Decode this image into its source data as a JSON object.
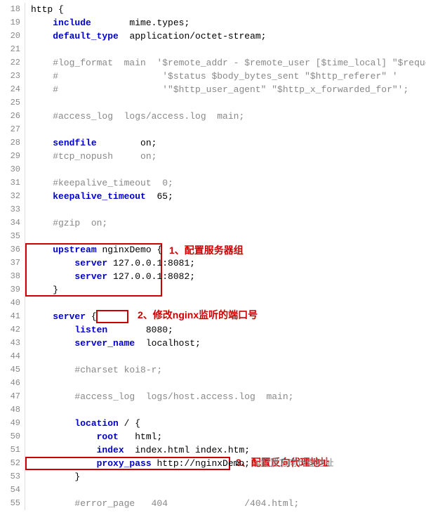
{
  "lines": [
    {
      "num": 18,
      "content": "http {",
      "tokens": [
        {
          "text": "http {",
          "class": "normal"
        }
      ]
    },
    {
      "num": 19,
      "content": "    include       mime.types;",
      "tokens": [
        {
          "text": "    ",
          "class": "normal"
        },
        {
          "text": "include",
          "class": "kw-blue"
        },
        {
          "text": "       mime.types;",
          "class": "normal"
        }
      ]
    },
    {
      "num": 20,
      "content": "    default_type  application/octet-stream;",
      "tokens": [
        {
          "text": "    ",
          "class": "normal"
        },
        {
          "text": "default_type",
          "class": "kw-blue"
        },
        {
          "text": "  application/octet-stream;",
          "class": "normal"
        }
      ]
    },
    {
      "num": 21,
      "content": "",
      "tokens": []
    },
    {
      "num": 22,
      "content": "    #log_format  main  '$remote_addr - $remote_user [$time_local] \"$request\" '",
      "tokens": [
        {
          "text": "    #log_format  main  '$remote_addr - $remote_user [$time_local] \"$request\" '",
          "class": "comment"
        }
      ]
    },
    {
      "num": 23,
      "content": "    #                   '$status $body_bytes_sent \"$http_referer\" '",
      "tokens": [
        {
          "text": "    #                   '$status $body_bytes_sent \"$http_referer\" '",
          "class": "comment"
        }
      ]
    },
    {
      "num": 24,
      "content": "    #                   '\"$http_user_agent\" \"$http_x_forwarded_for\"';",
      "tokens": [
        {
          "text": "    #                   '\"$http_user_agent\" \"$http_x_forwarded_for\"';",
          "class": "comment"
        }
      ]
    },
    {
      "num": 25,
      "content": "",
      "tokens": []
    },
    {
      "num": 26,
      "content": "    #access_log  logs/access.log  main;",
      "tokens": [
        {
          "text": "    #access_log  logs/access.log  main;",
          "class": "comment"
        }
      ]
    },
    {
      "num": 27,
      "content": "",
      "tokens": []
    },
    {
      "num": 28,
      "content": "    sendfile        on;",
      "tokens": [
        {
          "text": "    ",
          "class": "normal"
        },
        {
          "text": "sendfile",
          "class": "kw-blue"
        },
        {
          "text": "        on;",
          "class": "normal"
        }
      ]
    },
    {
      "num": 29,
      "content": "    #tcp_nopush     on;",
      "tokens": [
        {
          "text": "    #tcp_nopush     on;",
          "class": "comment"
        }
      ]
    },
    {
      "num": 30,
      "content": "",
      "tokens": []
    },
    {
      "num": 31,
      "content": "    #keepalive_timeout  0;",
      "tokens": [
        {
          "text": "    #keepalive_timeout  0;",
          "class": "comment"
        }
      ]
    },
    {
      "num": 32,
      "content": "    keepalive_timeout  65;",
      "tokens": [
        {
          "text": "    ",
          "class": "normal"
        },
        {
          "text": "keepalive_timeout",
          "class": "kw-blue"
        },
        {
          "text": "  65;",
          "class": "normal"
        }
      ]
    },
    {
      "num": 33,
      "content": "",
      "tokens": []
    },
    {
      "num": 34,
      "content": "    #gzip  on;",
      "tokens": [
        {
          "text": "    #gzip  on;",
          "class": "comment"
        }
      ]
    },
    {
      "num": 35,
      "content": "",
      "tokens": []
    },
    {
      "num": 36,
      "content": "    upstream nginxDemo {",
      "tokens": [
        {
          "text": "    ",
          "class": "normal"
        },
        {
          "text": "upstream",
          "class": "kw-blue"
        },
        {
          "text": " nginxDemo {",
          "class": "normal"
        }
      ]
    },
    {
      "num": 37,
      "content": "        server 127.0.0.1:8081;",
      "tokens": [
        {
          "text": "        ",
          "class": "normal"
        },
        {
          "text": "server",
          "class": "kw-blue"
        },
        {
          "text": " 127.0.0.1:8081;",
          "class": "normal"
        }
      ]
    },
    {
      "num": 38,
      "content": "        server 127.0.0.1:8082;",
      "tokens": [
        {
          "text": "        ",
          "class": "normal"
        },
        {
          "text": "server",
          "class": "kw-blue"
        },
        {
          "text": " 127.0.0.1:8082;",
          "class": "normal"
        }
      ]
    },
    {
      "num": 39,
      "content": "    }",
      "tokens": [
        {
          "text": "    }",
          "class": "normal"
        }
      ]
    },
    {
      "num": 40,
      "content": "",
      "tokens": []
    },
    {
      "num": 41,
      "content": "    server {",
      "tokens": [
        {
          "text": "    ",
          "class": "normal"
        },
        {
          "text": "server",
          "class": "kw-blue"
        },
        {
          "text": " {",
          "class": "normal"
        }
      ]
    },
    {
      "num": 42,
      "content": "        listen       8080;",
      "tokens": [
        {
          "text": "        ",
          "class": "normal"
        },
        {
          "text": "listen",
          "class": "kw-blue"
        },
        {
          "text": "       ",
          "class": "normal"
        },
        {
          "text": "8080;",
          "class": "normal",
          "highlight": "port"
        }
      ]
    },
    {
      "num": 43,
      "content": "        server_name  localhost;",
      "tokens": [
        {
          "text": "        ",
          "class": "normal"
        },
        {
          "text": "server_name",
          "class": "kw-blue"
        },
        {
          "text": "  localhost;",
          "class": "normal"
        }
      ]
    },
    {
      "num": 44,
      "content": "",
      "tokens": []
    },
    {
      "num": 45,
      "content": "        #charset koi8-r;",
      "tokens": [
        {
          "text": "        #charset koi8-r;",
          "class": "comment"
        }
      ]
    },
    {
      "num": 46,
      "content": "",
      "tokens": []
    },
    {
      "num": 47,
      "content": "        #access_log  logs/host.access.log  main;",
      "tokens": [
        {
          "text": "        #access_log  logs/host.access.log  main;",
          "class": "comment"
        }
      ]
    },
    {
      "num": 48,
      "content": "",
      "tokens": []
    },
    {
      "num": 49,
      "content": "        location / {",
      "tokens": [
        {
          "text": "        ",
          "class": "normal"
        },
        {
          "text": "location",
          "class": "kw-blue"
        },
        {
          "text": " / {",
          "class": "normal"
        }
      ]
    },
    {
      "num": 50,
      "content": "            root   html;",
      "tokens": [
        {
          "text": "            ",
          "class": "normal"
        },
        {
          "text": "root",
          "class": "kw-blue"
        },
        {
          "text": "   html;",
          "class": "normal"
        }
      ]
    },
    {
      "num": 51,
      "content": "            index  index.html index.htm;",
      "tokens": [
        {
          "text": "            ",
          "class": "normal"
        },
        {
          "text": "index",
          "class": "kw-blue"
        },
        {
          "text": "  index.html index.htm;",
          "class": "normal"
        }
      ]
    },
    {
      "num": 52,
      "content": "            proxy_pass http://nginxDemo; #配置方向代理地址",
      "tokens": [
        {
          "text": "            ",
          "class": "normal"
        },
        {
          "text": "proxy_pass",
          "class": "kw-blue"
        },
        {
          "text": " http://nginxDemo;",
          "class": "normal",
          "highlight": "proxy"
        },
        {
          "text": " #配置方向代理地址",
          "class": "comment"
        }
      ]
    },
    {
      "num": 53,
      "content": "        }",
      "tokens": [
        {
          "text": "        }",
          "class": "normal"
        }
      ]
    },
    {
      "num": 54,
      "content": "",
      "tokens": []
    },
    {
      "num": 55,
      "content": "        #error_page   404              /404.html;",
      "tokens": [
        {
          "text": "        #error_page   404              /404.html;",
          "class": "comment"
        }
      ]
    }
  ],
  "annotations": {
    "ann1": "1、配置服务器组",
    "ann2": "2、修改nginx监听的端口号",
    "ann3": "3、配置反向代理地址"
  }
}
